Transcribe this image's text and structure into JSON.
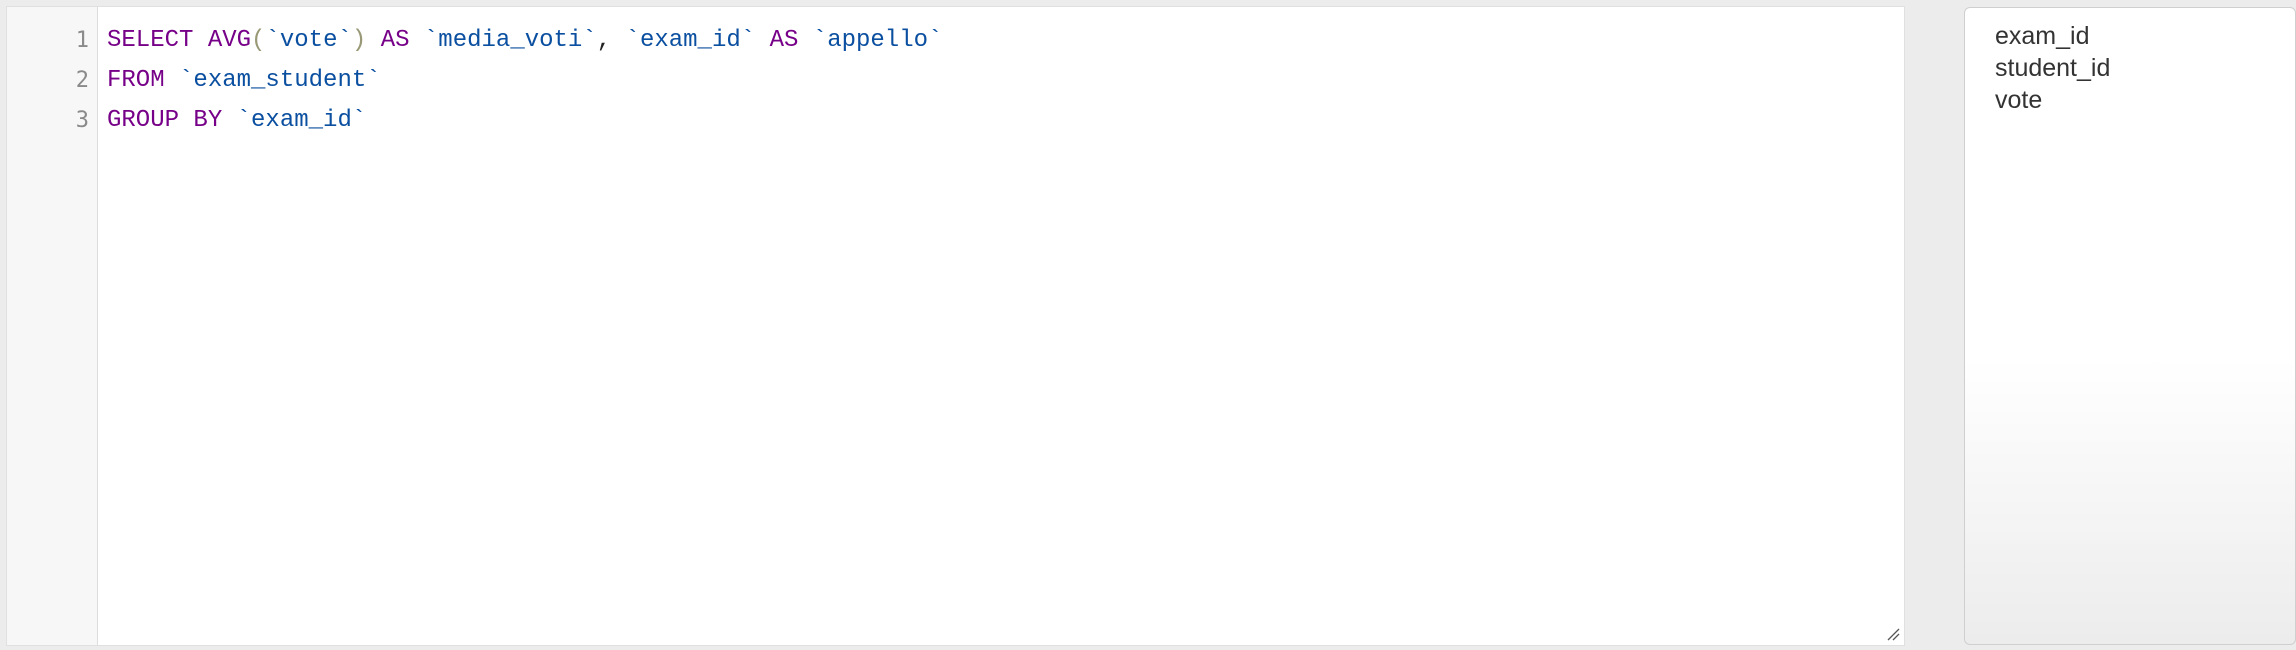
{
  "editor": {
    "line_numbers": [
      "1",
      "2",
      "3"
    ],
    "lines": [
      {
        "tokens": [
          {
            "type": "kw",
            "text": "SELECT"
          },
          {
            "type": "plain",
            "text": " "
          },
          {
            "type": "kw",
            "text": "AVG"
          },
          {
            "type": "paren",
            "text": "("
          },
          {
            "type": "str",
            "text": "`vote`"
          },
          {
            "type": "paren",
            "text": ")"
          },
          {
            "type": "plain",
            "text": " "
          },
          {
            "type": "kw",
            "text": "AS"
          },
          {
            "type": "plain",
            "text": " "
          },
          {
            "type": "str",
            "text": "`media_voti`"
          },
          {
            "type": "plain",
            "text": ", "
          },
          {
            "type": "str",
            "text": "`exam_id`"
          },
          {
            "type": "plain",
            "text": " "
          },
          {
            "type": "kw",
            "text": "AS"
          },
          {
            "type": "plain",
            "text": " "
          },
          {
            "type": "str",
            "text": "`appello`"
          }
        ]
      },
      {
        "tokens": [
          {
            "type": "kw",
            "text": "FROM"
          },
          {
            "type": "plain",
            "text": " "
          },
          {
            "type": "str",
            "text": "`exam_student`"
          }
        ]
      },
      {
        "tokens": [
          {
            "type": "kw",
            "text": "GROUP BY"
          },
          {
            "type": "plain",
            "text": " "
          },
          {
            "type": "str",
            "text": "`exam_id`"
          }
        ]
      }
    ]
  },
  "columns_panel": {
    "items": [
      "exam_id",
      "student_id",
      "vote"
    ]
  },
  "colors": {
    "keyword": "#770088",
    "identifier": "#0b4fa0",
    "paren": "#999977"
  }
}
